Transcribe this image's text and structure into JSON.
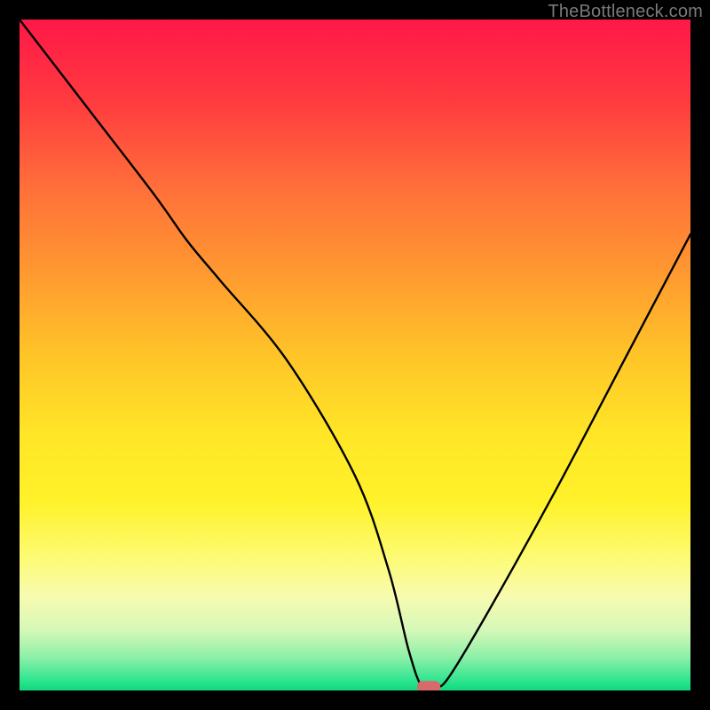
{
  "watermark": "TheBottleneck.com",
  "chart_data": {
    "type": "line",
    "title": "",
    "xlabel": "",
    "ylabel": "",
    "xlim": [
      0,
      100
    ],
    "ylim": [
      0,
      100
    ],
    "grid": false,
    "legend": false,
    "series": [
      {
        "name": "bottleneck-curve",
        "x": [
          0,
          10,
          20,
          25,
          30,
          40,
          50,
          55,
          58,
          60,
          62,
          64,
          70,
          80,
          90,
          100
        ],
        "values": [
          100,
          87,
          74,
          67,
          61,
          49,
          32,
          18,
          6,
          0.5,
          0.5,
          2,
          12,
          30,
          49,
          68
        ]
      }
    ],
    "marker": {
      "x": 61,
      "y": 0.5,
      "color": "#d96a6a"
    },
    "gradient_stops": [
      {
        "offset": 0.0,
        "color": "#ff1848"
      },
      {
        "offset": 0.12,
        "color": "#ff3a3f"
      },
      {
        "offset": 0.25,
        "color": "#ff6f3a"
      },
      {
        "offset": 0.38,
        "color": "#ff9a30"
      },
      {
        "offset": 0.5,
        "color": "#ffc428"
      },
      {
        "offset": 0.62,
        "color": "#ffe627"
      },
      {
        "offset": 0.72,
        "color": "#fff22a"
      },
      {
        "offset": 0.8,
        "color": "#fdfb72"
      },
      {
        "offset": 0.86,
        "color": "#f7fbb0"
      },
      {
        "offset": 0.91,
        "color": "#d6f8b8"
      },
      {
        "offset": 0.95,
        "color": "#8ef0a8"
      },
      {
        "offset": 0.985,
        "color": "#2fe590"
      },
      {
        "offset": 1.0,
        "color": "#0fd97c"
      }
    ]
  }
}
